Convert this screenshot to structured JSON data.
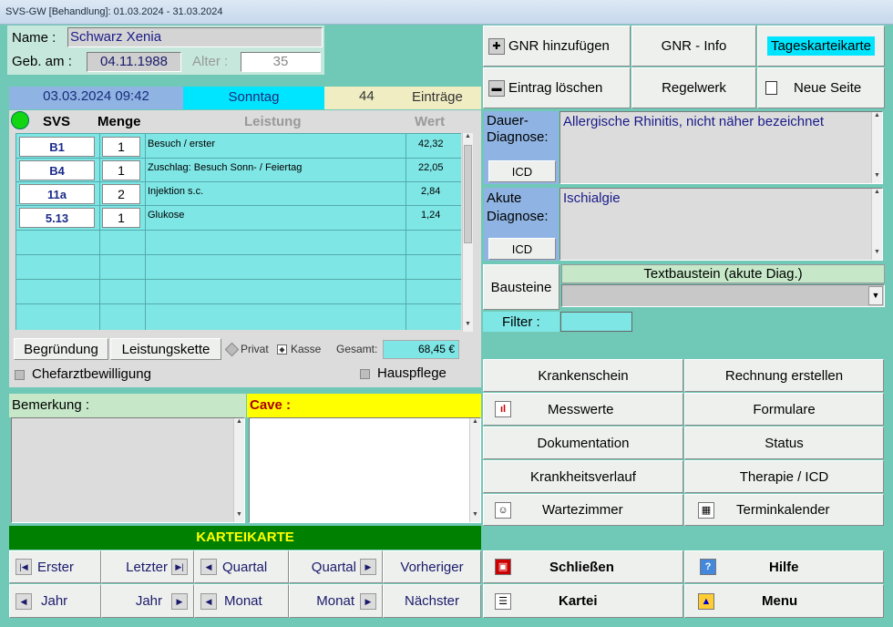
{
  "window": {
    "title": "SVS-GW [Behandlung]: 01.03.2024 - 31.03.2024"
  },
  "patient": {
    "name_label": "Name :",
    "name": "Schwarz Xenia",
    "dob_label": "Geb. am :",
    "dob": "04.11.1988",
    "age_label": "Alter :",
    "age": "35"
  },
  "visit": {
    "datetime": "03.03.2024 09:42",
    "weekday": "Sonntag",
    "count": "44",
    "entries_label": "Einträge"
  },
  "table": {
    "headers": {
      "svs": "SVS",
      "menge": "Menge",
      "leistung": "Leistung",
      "wert": "Wert"
    },
    "rows": [
      {
        "svs": "B1",
        "menge": "1",
        "leistung": "Besuch / erster",
        "wert": "42,32"
      },
      {
        "svs": "B4",
        "menge": "1",
        "leistung": "Zuschlag: Besuch Sonn- / Feiertag",
        "wert": "22,05"
      },
      {
        "svs": "11a",
        "menge": "2",
        "leistung": "Injektion s.c.",
        "wert": "2,84"
      },
      {
        "svs": "5.13",
        "menge": "1",
        "leistung": "Glukose",
        "wert": "1,24"
      }
    ]
  },
  "footer": {
    "begruendung": "Begründung",
    "leistungskette": "Leistungskette",
    "privat": "Privat",
    "kasse": "Kasse",
    "gesamt_label": "Gesamt:",
    "gesamt": "68,45 €",
    "chefarzt": "Chefarztbewilligung",
    "hauspflege": "Hauspflege"
  },
  "notes": {
    "bemerkung": "Bemerkung :",
    "cave": "Cave :"
  },
  "karteikarte": {
    "header": "KARTEIKARTE",
    "nav": {
      "erster": "Erster",
      "letzter": "Letzter",
      "quartal_prev": "Quartal",
      "quartal_next": "Quartal",
      "vorheriger": "Vorheriger",
      "jahr_prev": "Jahr",
      "jahr_next": "Jahr",
      "monat_prev": "Monat",
      "monat_next": "Monat",
      "naechster": "Nächster"
    }
  },
  "right_top": {
    "gnr_add": "GNR hinzufügen",
    "gnr_info": "GNR - Info",
    "tageskarteikarte": "Tageskarteikarte",
    "eintrag_loeschen": "Eintrag löschen",
    "regelwerk": "Regelwerk",
    "neue_seite": "Neue Seite"
  },
  "diagnoses": {
    "dauer_label": "Dauer-\nDiagnose:",
    "dauer_text": "Allergische Rhinitis, nicht näher bezeichnet",
    "akute_label": "Akute\nDiagnose:",
    "akute_text": "Ischialgie",
    "icd": "ICD",
    "bausteine": "Bausteine",
    "textbaustein": "Textbaustein (akute Diag.)",
    "filter": "Filter :"
  },
  "actions": {
    "krankenschein": "Krankenschein",
    "rechnung": "Rechnung erstellen",
    "messwerte": "Messwerte",
    "formulare": "Formulare",
    "dokumentation": "Dokumentation",
    "status": "Status",
    "krankheitsverlauf": "Krankheitsverlauf",
    "therapie": "Therapie / ICD",
    "wartezimmer": "Wartezimmer",
    "terminkalender": "Terminkalender",
    "schliessen": "Schließen",
    "hilfe": "Hilfe",
    "kartei": "Kartei",
    "menu": "Menu"
  },
  "colors": {
    "background": "#70c9b7",
    "grid": "#7fe6e6",
    "date": "#8fb4e3",
    "weekday": "#00e5ff",
    "count": "#f0edc2",
    "cave": "#ffff00",
    "karteikarte": "#008000",
    "karteikarte_text": "#ffff00"
  }
}
